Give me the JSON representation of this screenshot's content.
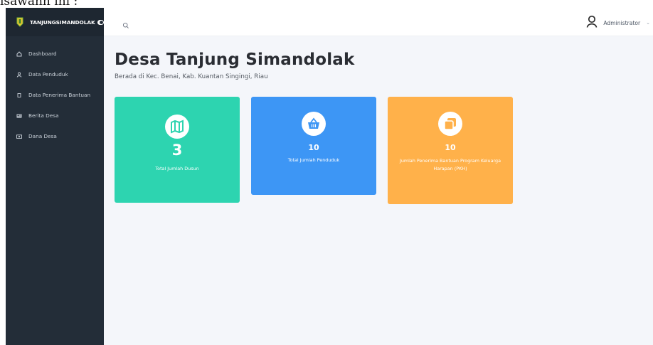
{
  "caption_fragment": "isawann ini :",
  "sidebar": {
    "brand": "TANJUNGSIMANDOLAK",
    "items": [
      {
        "label": "Dashboard",
        "icon": "home-icon"
      },
      {
        "label": "Data Penduduk",
        "icon": "user-icon"
      },
      {
        "label": "Data Penerima Bantuan",
        "icon": "square-icon"
      },
      {
        "label": "Berita Desa",
        "icon": "newspaper-icon"
      },
      {
        "label": "Dana Desa",
        "icon": "money-icon"
      }
    ]
  },
  "header": {
    "user_name": "Administrator",
    "caret": "⌄"
  },
  "main": {
    "title": "Desa Tanjung Simandolak",
    "subtitle": "Berada di Kec. Benai, Kab. Kuantan Singingi, Riau",
    "cards": [
      {
        "value": "3",
        "label": "Total Jumlah Dusun",
        "color": "#2dd4b0",
        "icon": "map-icon"
      },
      {
        "value": "10",
        "label": "Total Jumlah Penduduk",
        "color": "#3d96f5",
        "icon": "basket-icon"
      },
      {
        "value": "10",
        "label": "Jumlah Penerima Bantuan Program Keluarga Harapan (PKH)",
        "color": "#ffb14a",
        "icon": "copy-icon"
      }
    ]
  }
}
